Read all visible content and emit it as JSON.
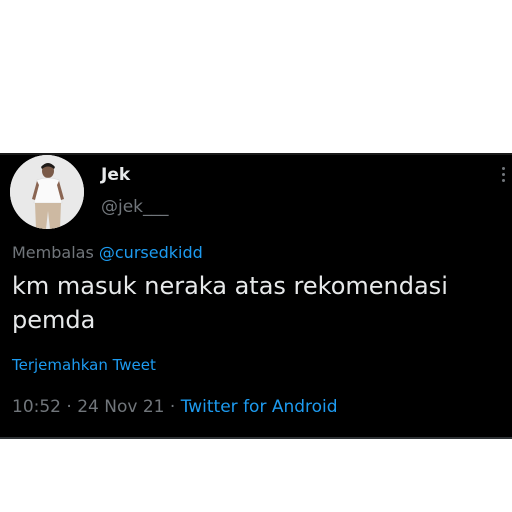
{
  "tweet": {
    "display_name": "Jek",
    "handle": "@jek___",
    "reply_prefix": "Membalas",
    "reply_to": "@cursedkidd",
    "text": "km masuk neraka atas rekomendasi pemda",
    "translate_label": "Terjemahkan Tweet",
    "time": "10:52",
    "date": "24 Nov 21",
    "separator": "·",
    "source": "Twitter for Android"
  },
  "icons": {
    "more": "more-vertical-icon",
    "avatar": "profile-photo"
  },
  "colors": {
    "background": "#000000",
    "text": "#e7e9ea",
    "muted": "#71767b",
    "link": "#1d9bf0"
  }
}
